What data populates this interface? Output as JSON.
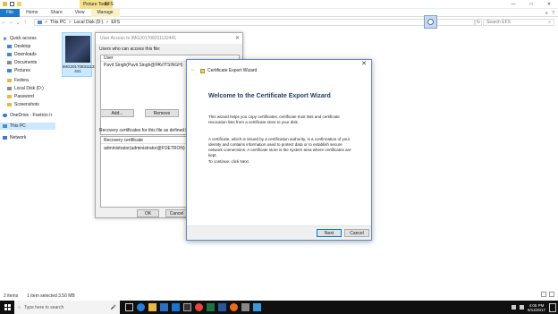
{
  "window": {
    "context_tab": "Picture Tools",
    "title": "EFS",
    "controls": [
      "—",
      "□",
      "✕"
    ]
  },
  "ribbon": {
    "tabs": [
      "File",
      "Home",
      "Share",
      "View",
      "Manage"
    ],
    "right_icons": [
      "∨",
      "?"
    ]
  },
  "addressbar": {
    "back": "←",
    "forward": "→",
    "up": "↑",
    "path": [
      "This PC",
      "Local Disk (D:)",
      "EFS"
    ],
    "separator": ">",
    "refresh": "↻",
    "search_placeholder": "Search EFS",
    "search_icon": "⌕"
  },
  "navpane": {
    "items": [
      {
        "label": "Quick access",
        "icon": "star-icon"
      },
      {
        "label": "Desktop",
        "icon": "desktop-icon"
      },
      {
        "label": "Downloads",
        "icon": "downloads-icon"
      },
      {
        "label": "Documents",
        "icon": "documents-icon"
      },
      {
        "label": "Pictures",
        "icon": "pictures-icon"
      },
      {
        "label": "Fedora",
        "icon": "folder-icon"
      },
      {
        "label": "Local Disk (D:)",
        "icon": "drive-icon"
      },
      {
        "label": "Password",
        "icon": "folder-icon"
      },
      {
        "label": "Screenshots",
        "icon": "folder-icon"
      },
      {
        "label": "OneDrive - Foetron Ir",
        "icon": "onedrive-icon"
      },
      {
        "label": "This PC",
        "icon": "pc-icon"
      },
      {
        "label": "Network",
        "icon": "network-icon"
      }
    ]
  },
  "file_item": {
    "name_line1": "IMG201708311132",
    "name_line2": "441"
  },
  "statusbar": {
    "items": "2 items",
    "selected": "1 item selected  3.50 MB"
  },
  "user_access_dialog": {
    "title": "User Access to IMG201708311132441",
    "users_label": "Users who can access this file:",
    "users_header": "User",
    "users": [
      "Pavit Singh(Pavit Singh@PAVITSINGH)"
    ],
    "add_button": "Add...",
    "remove_button": "Remove",
    "recovery_label": "Recovery certificates for this file as defined by recovery policy:",
    "recovery_header": "Recovery certificate",
    "recovery_entries": [
      "administrator(administrator@FOETRON)"
    ],
    "ok_button": "OK",
    "cancel_button": "Cancel"
  },
  "wizard": {
    "back": "←",
    "title": "Certificate Export Wizard",
    "close": "✕",
    "heading": "Welcome to the Certificate Export Wizard",
    "paragraph1": "This wizard helps you copy certificates, certificate trust lists and certificate revocation lists from a certificate store to your disk.",
    "paragraph2": "A certificate, which is issued by a certification authority, is a confirmation of your identity and contains information used to protect data or to establish secure network connections. A certificate store is the system area where certificates are kept.",
    "paragraph3": "To continue, click Next.",
    "next_button": "Next",
    "cancel_button": "Cancel"
  },
  "taskbar": {
    "search_placeholder": "Type here to search",
    "time": "4:05 PM",
    "date": "9/14/2017",
    "mic": "🎤",
    "apps": [
      "task-view-icon",
      "edge-icon",
      "explorer-icon",
      "store-icon",
      "mail-icon",
      "terminal-icon",
      "chrome-icon",
      "excel-icon",
      "word-icon",
      "firefox-icon",
      "settings-icon",
      "photos-icon"
    ]
  },
  "colors": {
    "accent": "#0078d7",
    "file_tab": "#1979ca",
    "context_tab": "#f4e08e",
    "selection": "#cce8ff",
    "taskbar": "#101010"
  }
}
